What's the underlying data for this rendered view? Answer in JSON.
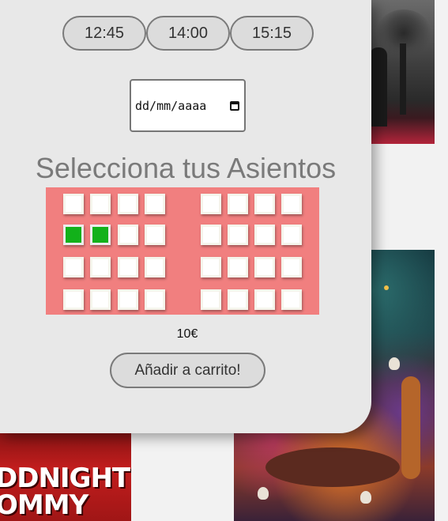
{
  "times": [
    "12:45",
    "14:00",
    "15:15"
  ],
  "date": {
    "placeholder": "dd/mm/aaaa"
  },
  "seats": {
    "title": "Selecciona tus Asientos",
    "rows": 4,
    "cols": 8,
    "aisle_after_col": 4,
    "selected": [
      [
        1,
        0
      ],
      [
        1,
        1
      ]
    ],
    "colors": {
      "map_background": "#f17f7f",
      "selected": "#12b11a",
      "free": "#ffffff"
    }
  },
  "price": "10€",
  "cart_button": "Añadir a carrito!",
  "posters": {
    "red_title_lines": [
      "DDNIGHT",
      "OMMY"
    ]
  }
}
